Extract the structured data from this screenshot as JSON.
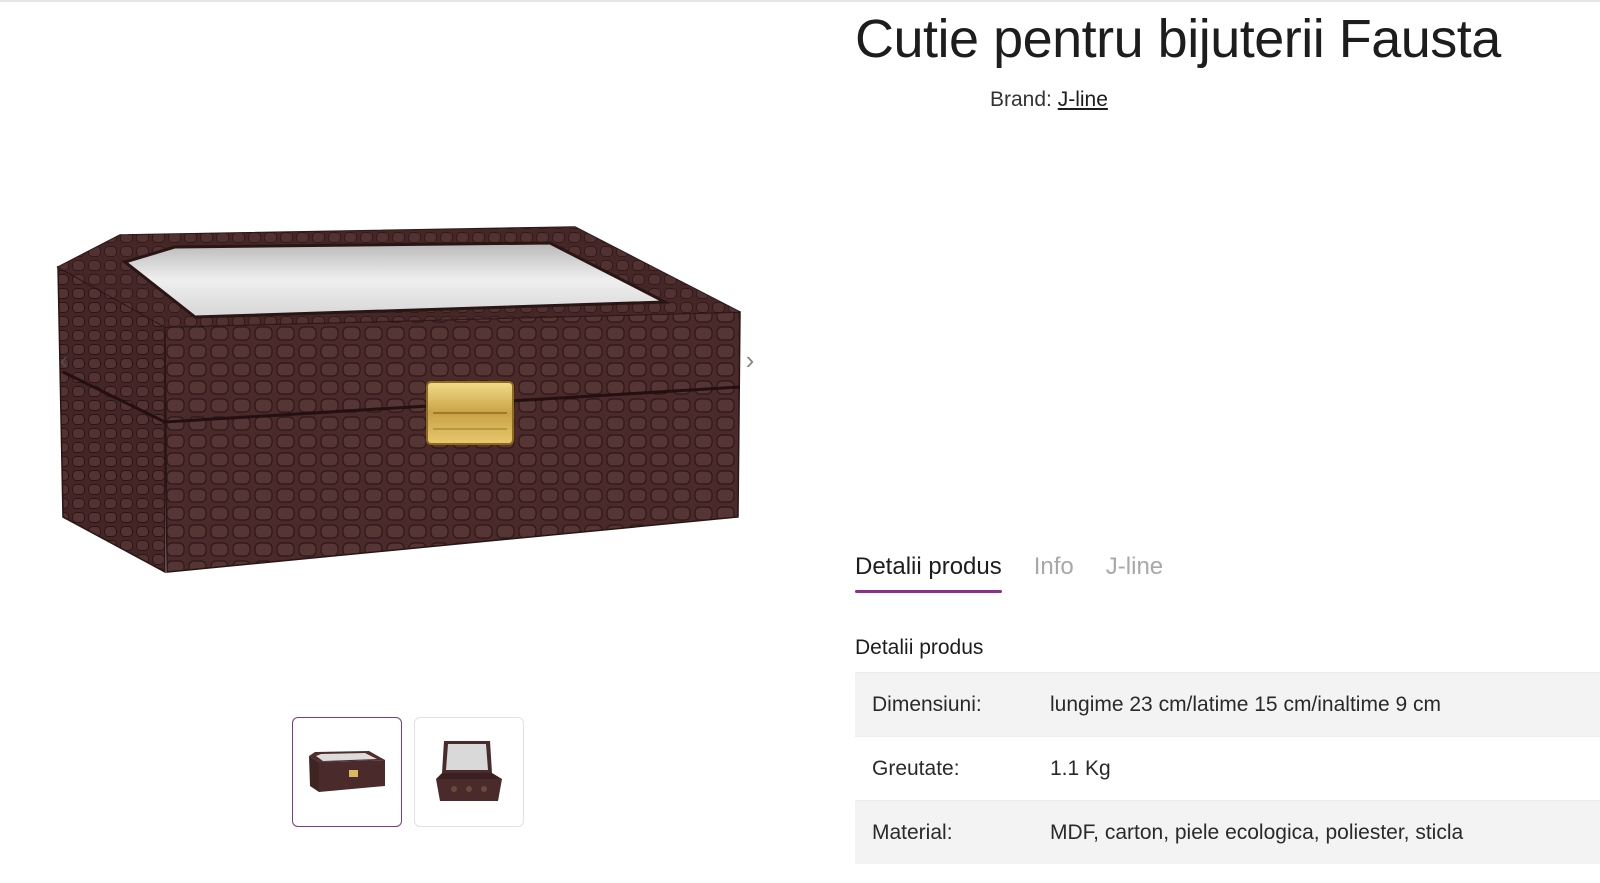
{
  "product": {
    "title": "Cutie pentru bijuterii Fausta",
    "brand_label": "Brand:",
    "brand_name": "J-line"
  },
  "gallery": {
    "prev_arrow": "‹",
    "next_arrow": "›",
    "thumbnails": [
      {
        "name": "closed-box-view",
        "active": true
      },
      {
        "name": "open-box-view",
        "active": false
      }
    ]
  },
  "tabs": [
    {
      "label": "Detalii produs",
      "active": true
    },
    {
      "label": "Info",
      "active": false
    },
    {
      "label": "J-line",
      "active": false
    }
  ],
  "details": {
    "section_title": "Detalii produs",
    "rows": [
      {
        "key": "Dimensiuni:",
        "value": "lungime 23 cm/latime 15 cm/inaltime 9 cm"
      },
      {
        "key": "Greutate:",
        "value": "1.1 Kg"
      },
      {
        "key": "Material:",
        "value": "MDF, carton, piele ecologica, poliester, sticla"
      }
    ]
  },
  "colors": {
    "accent": "#8e2f8f",
    "box_leather": "#4a2a2a",
    "clasp_gold": "#d8b860"
  }
}
